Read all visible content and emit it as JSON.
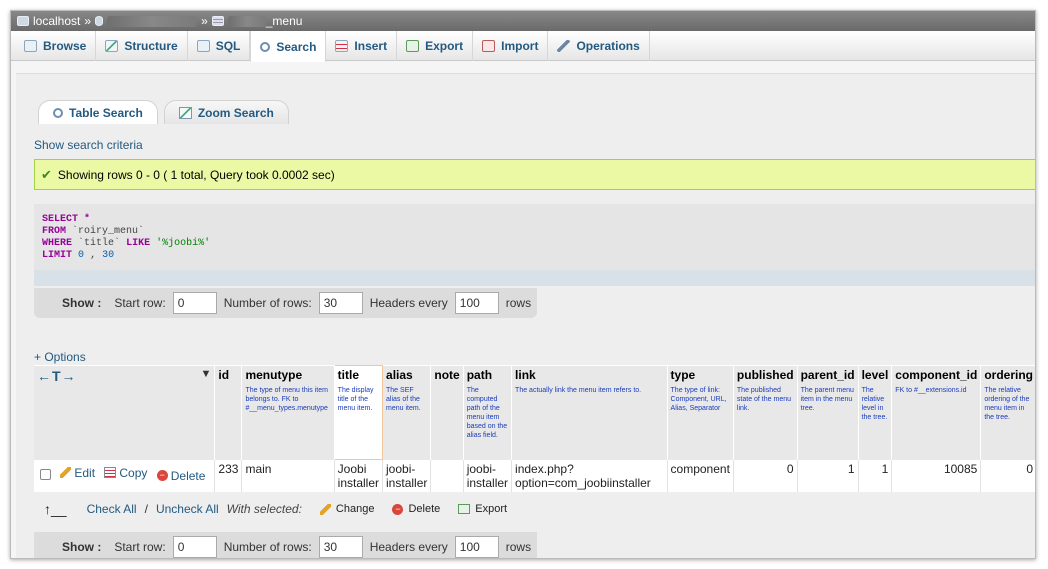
{
  "breadcrumb": {
    "server": "localhost",
    "separator": "»",
    "table_suffix": "_menu"
  },
  "tabs": [
    {
      "label": "Browse",
      "icon": "browse-icon"
    },
    {
      "label": "Structure",
      "icon": "structure-icon"
    },
    {
      "label": "SQL",
      "icon": "sql-icon"
    },
    {
      "label": "Search",
      "icon": "search-icon"
    },
    {
      "label": "Insert",
      "icon": "insert-icon"
    },
    {
      "label": "Export",
      "icon": "export-icon"
    },
    {
      "label": "Import",
      "icon": "import-icon"
    },
    {
      "label": "Operations",
      "icon": "operations-icon"
    }
  ],
  "active_tab": "Search",
  "subtabs": {
    "table_search": "Table Search",
    "zoom_search": "Zoom Search"
  },
  "show_criteria": "Show search criteria",
  "message": "Showing rows 0 - 0 ( 1 total, Query took 0.0002 sec)",
  "sql": {
    "select": "SELECT",
    "star": "*",
    "from": "FROM",
    "table": "`roiry_menu`",
    "where": "WHERE",
    "column": "`title`",
    "like": "LIKE",
    "pattern": "'%joobi%'",
    "limit": "LIMIT",
    "limit_start": "0",
    "limit_sep": ",",
    "limit_count": "30"
  },
  "nav": {
    "show": "Show :",
    "start_row_label": "Start row:",
    "start_row": "0",
    "num_rows_label": "Number of rows:",
    "num_rows": "30",
    "headers_every_label": "Headers every",
    "headers_every": "100",
    "rows_label": "rows"
  },
  "options_link": "+ Options",
  "table": {
    "arrows": "←T→",
    "columns": [
      {
        "name": "id",
        "comment": ""
      },
      {
        "name": "menutype",
        "comment": "The type of menu this item belongs to. FK to #__menu_types.menutype"
      },
      {
        "name": "title",
        "comment": "The display title of the menu item."
      },
      {
        "name": "alias",
        "comment": "The SEF alias of the menu item."
      },
      {
        "name": "note",
        "comment": ""
      },
      {
        "name": "path",
        "comment": "The computed path of the menu item based on the alias field."
      },
      {
        "name": "link",
        "comment": "The actually link the menu item refers to."
      },
      {
        "name": "type",
        "comment": "The type of link: Component, URL, Alias, Separator"
      },
      {
        "name": "published",
        "comment": "The published state of the menu link."
      },
      {
        "name": "parent_id",
        "comment": "The parent menu item in the menu tree."
      },
      {
        "name": "level",
        "comment": "The relative level in the tree."
      },
      {
        "name": "component_id",
        "comment": "FK to #__extensions.id"
      },
      {
        "name": "ordering",
        "comment": "The relative ordering of the menu item in the tree."
      }
    ],
    "row": {
      "edit": "Edit",
      "copy": "Copy",
      "delete": "Delete",
      "id": "233",
      "menutype": "main",
      "title": "Joobi installer",
      "alias": "joobi-installer",
      "note": "",
      "path": "joobi-installer",
      "link": "index.php?option=com_joobiinstaller",
      "type": "component",
      "published": "0",
      "parent_id": "1",
      "level": "1",
      "component_id": "10085",
      "ordering": "0"
    }
  },
  "bulk": {
    "check_all": "Check All",
    "slash": "/",
    "uncheck_all": "Uncheck All",
    "with_selected": "With selected:",
    "change": "Change",
    "delete": "Delete",
    "export": "Export"
  }
}
